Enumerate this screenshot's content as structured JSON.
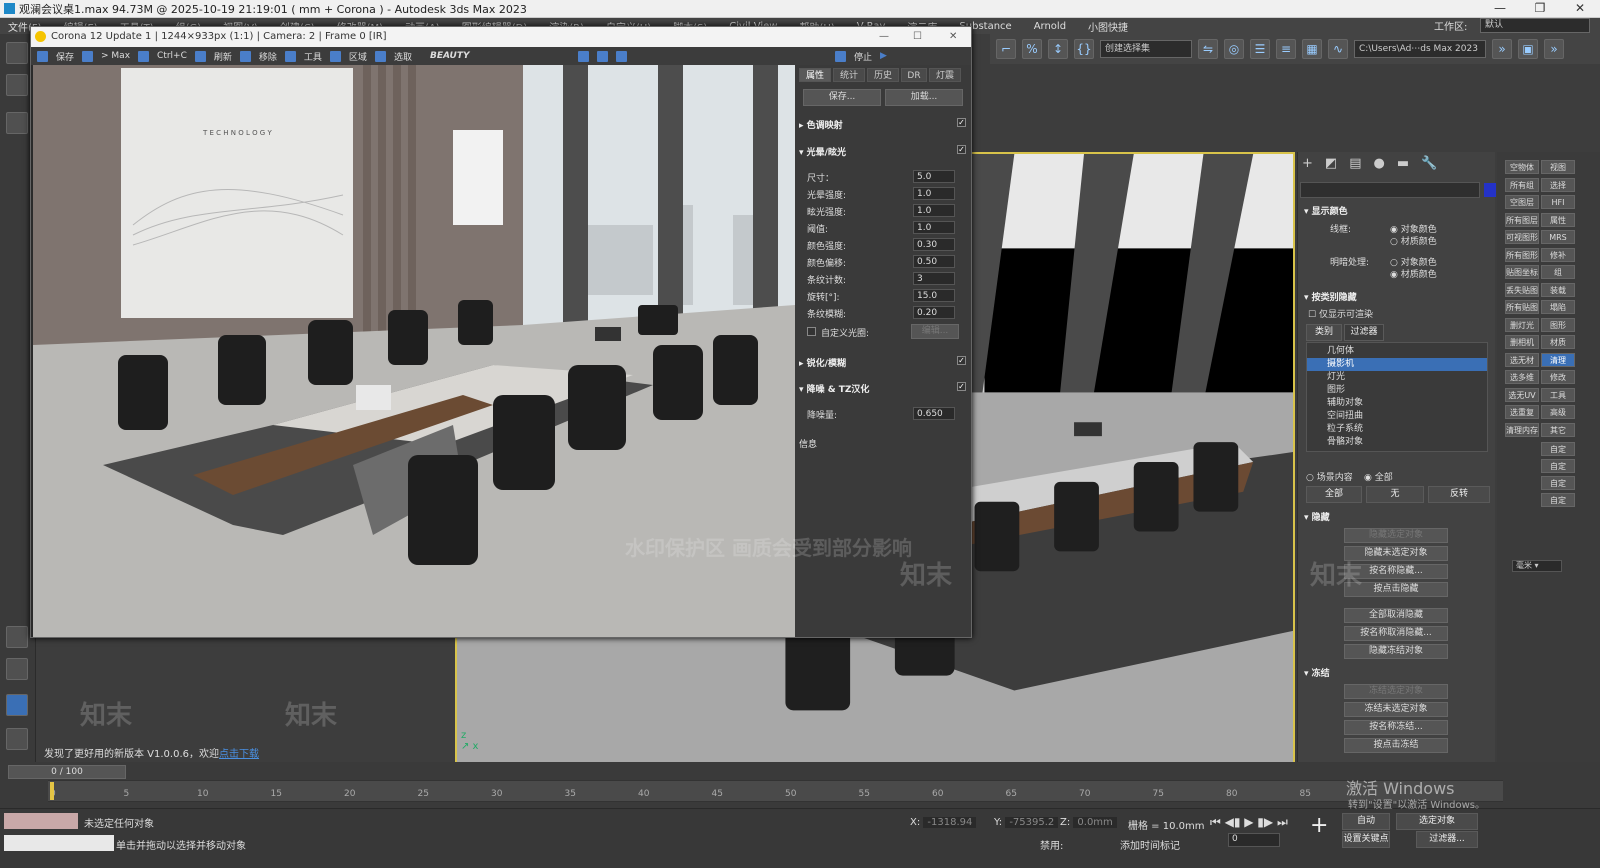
{
  "window": {
    "title": "观澜会议桌1.max  94.73M @ 2025-10-19 21:19:01  ( mm + Corona ) - Autodesk 3ds Max 2023"
  },
  "menu": [
    "文件(F)",
    "编辑(E)",
    "工具(T)",
    "组(G)",
    "视图(V)",
    "创建(C)",
    "修改器(M)",
    "动画(A)",
    "图形编辑器(D)",
    "渲染(R)",
    "自定义(U)",
    "脚本(S)",
    "Civil View",
    "帮助(H)",
    "V-Ray",
    "渲云库",
    "Substance",
    "Arnold",
    "小图快捷"
  ],
  "workspace": {
    "label": "工作区:",
    "value": "默认"
  },
  "main_toolbar": {
    "selection_set": "创建选择集",
    "path": "C:\\Users\\Ad⋯ds Max 2023"
  },
  "corona": {
    "title": "Corona 12 Update 1 | 1244×933px (1:1) | Camera: 2 | Frame 0 [IR]",
    "toolbar": [
      "保存",
      "> Max",
      "Ctrl+C",
      "刷新",
      "移除",
      "工具",
      "区域",
      "选取"
    ],
    "beauty": "BEAUTY",
    "stop": "停止",
    "tabs": [
      "属性",
      "统计",
      "历史",
      "DR",
      "灯震"
    ],
    "save_btn": "保存...",
    "load_btn": "加载...",
    "sections": {
      "tone": "色调映射",
      "bloom": "光晕/眩光",
      "sharpen": "锐化/模糊",
      "denoise": "降噪 & TZ汉化",
      "info": "信息"
    },
    "bloom_params": [
      {
        "label": "尺寸：",
        "value": "5.0"
      },
      {
        "label": "光晕强度:",
        "value": "1.0"
      },
      {
        "label": "眩光强度:",
        "value": "1.0"
      },
      {
        "label": "阈值:",
        "value": "1.0"
      },
      {
        "label": "颜色强度:",
        "value": "0.30"
      },
      {
        "label": "颜色偏移:",
        "value": "0.50"
      },
      {
        "label": "条纹计数:",
        "value": "3"
      },
      {
        "label": "旋转[°]:",
        "value": "15.0"
      },
      {
        "label": "条纹模糊:",
        "value": "0.20"
      }
    ],
    "custom_aperture": "自定义光圈:",
    "edit": "编辑...",
    "denoise_label": "降噪量:",
    "denoise_value": "0.650"
  },
  "cmd": {
    "display_color": "显示颜色",
    "wire": "线框:",
    "shaded": "明暗处理:",
    "obj_color": "对象颜色",
    "mat_color": "材质颜色",
    "hide_by_cat": "按类别隐藏",
    "only_renderable": "仅显示可渲染",
    "tab_cat": "类别",
    "tab_filter": "过滤器",
    "categories": [
      "几何体",
      "摄影机",
      "灯光",
      "图形",
      "辅助对象",
      "空间扭曲",
      "粒子系统",
      "骨骼对象"
    ],
    "scene_content": "场景内容",
    "all": "全部",
    "btn_all": "全部",
    "btn_none": "无",
    "btn_invert": "反转",
    "hide": "隐藏",
    "hide_btns": [
      "隐藏选定对象",
      "隐藏未选定对象",
      "按名称隐藏...",
      "按点击隐藏",
      "全部取消隐藏",
      "按名称取消隐藏...",
      "隐藏冻结对象"
    ],
    "freeze": "冻结",
    "freeze_btns": [
      "冻结选定对象",
      "冻结未选定对象",
      "按名称冻结...",
      "按点击冻结"
    ]
  },
  "scene_panel": [
    "空物体",
    "视图",
    "所有组",
    "选择",
    "空图层",
    "HFI",
    "所有图层",
    "属性",
    "可视图形",
    "MRS",
    "所有图形",
    "修补",
    "贴图坐标",
    "组",
    "丢失贴图",
    "装载",
    "所有贴图",
    "塌陷",
    "删灯光",
    "图形",
    "删相机",
    "材质",
    "选无材",
    "清理",
    "选多维",
    "修改",
    "选无UV",
    "工具",
    "选重复",
    "高级",
    "清理内存",
    "其它"
  ],
  "scene_extra": [
    "自定",
    "自定",
    "自定",
    "自定"
  ],
  "units": "毫米",
  "update_notice": {
    "text": "发现了更好用的新版本 V1.0.0.6，欢迎",
    "link": "点击下载"
  },
  "time": {
    "frame": "0 / 100",
    "ticks": [
      "0",
      "5",
      "10",
      "15",
      "20",
      "25",
      "30",
      "35",
      "40",
      "45",
      "50",
      "55",
      "60",
      "65",
      "70",
      "75",
      "80",
      "85"
    ]
  },
  "status": {
    "line1": "未选定任何对象",
    "line2": "单击并拖动以选择并移动对象",
    "x": "-1318.94",
    "y": "-75395.2",
    "z": "0.0mm",
    "grid": "栅格 = 10.0mm",
    "disabled": "禁用:",
    "add_time_tag": "添加时间标记",
    "auto": "自动",
    "selected": "选定对象",
    "set_key": "设置关键点",
    "filters": "过滤器...",
    "frame": "0"
  },
  "activation": {
    "title": "激活 Windows",
    "sub": "转到\"设置\"以激活 Windows。"
  },
  "watermark": {
    "main": "水印保护区  画质会受到部分影响",
    "brand": "知末"
  }
}
